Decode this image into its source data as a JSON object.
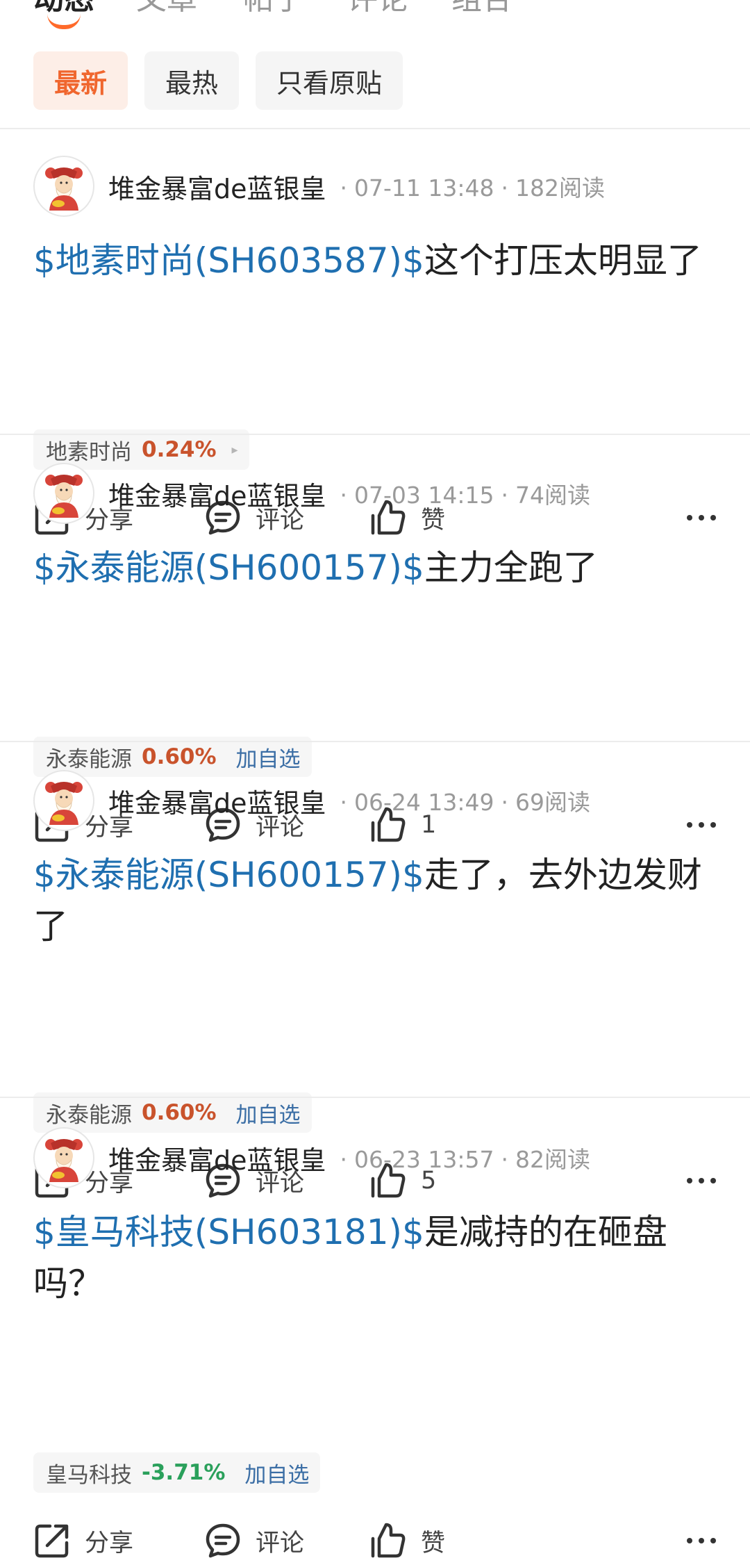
{
  "top_tabs": [
    {
      "label": "动态",
      "active": true
    },
    {
      "label": "文章",
      "active": false
    },
    {
      "label": "帖子",
      "active": false
    },
    {
      "label": "评论",
      "active": false
    },
    {
      "label": "组合",
      "active": false
    }
  ],
  "filters": [
    {
      "label": "最新",
      "active": true
    },
    {
      "label": "最热",
      "active": false
    },
    {
      "label": "只看原贴",
      "active": false
    }
  ],
  "colors": {
    "accent": "#f0662e",
    "link": "#1f6fb0",
    "up": "#c9532c",
    "down": "#2aa05b"
  },
  "actions_labels": {
    "share": "分享",
    "comment": "评论",
    "like_default": "赞"
  },
  "posts": [
    {
      "username": "堆金暴富de蓝银皇",
      "time": "07-11 13:48",
      "reads": "182阅读",
      "stock_tag": "$地素时尚(SH603587)$",
      "text": "这个打压太明显了",
      "chip": {
        "name": "地素时尚",
        "pct": "0.24%",
        "direction": "up",
        "extra": "",
        "arrow": "▸"
      },
      "like": "赞"
    },
    {
      "username": "堆金暴富de蓝银皇",
      "time": "07-03 14:15",
      "reads": "74阅读",
      "stock_tag": "$永泰能源(SH600157)$",
      "text": "主力全跑了",
      "chip": {
        "name": "永泰能源",
        "pct": "0.60%",
        "direction": "up",
        "extra": "加自选",
        "arrow": ""
      },
      "like": "1"
    },
    {
      "username": "堆金暴富de蓝银皇",
      "time": "06-24 13:49",
      "reads": "69阅读",
      "stock_tag": "$永泰能源(SH600157)$",
      "text": "走了，去外边发财了",
      "chip": {
        "name": "永泰能源",
        "pct": "0.60%",
        "direction": "up",
        "extra": "加自选",
        "arrow": ""
      },
      "like": "5"
    },
    {
      "username": "堆金暴富de蓝银皇",
      "time": "06-23 13:57",
      "reads": "82阅读",
      "stock_tag": "$皇马科技(SH603181)$",
      "text": "是减持的在砸盘吗？",
      "chip": {
        "name": "皇马科技",
        "pct": "-3.71%",
        "direction": "down",
        "extra": "加自选",
        "arrow": ""
      },
      "like": "赞"
    }
  ]
}
